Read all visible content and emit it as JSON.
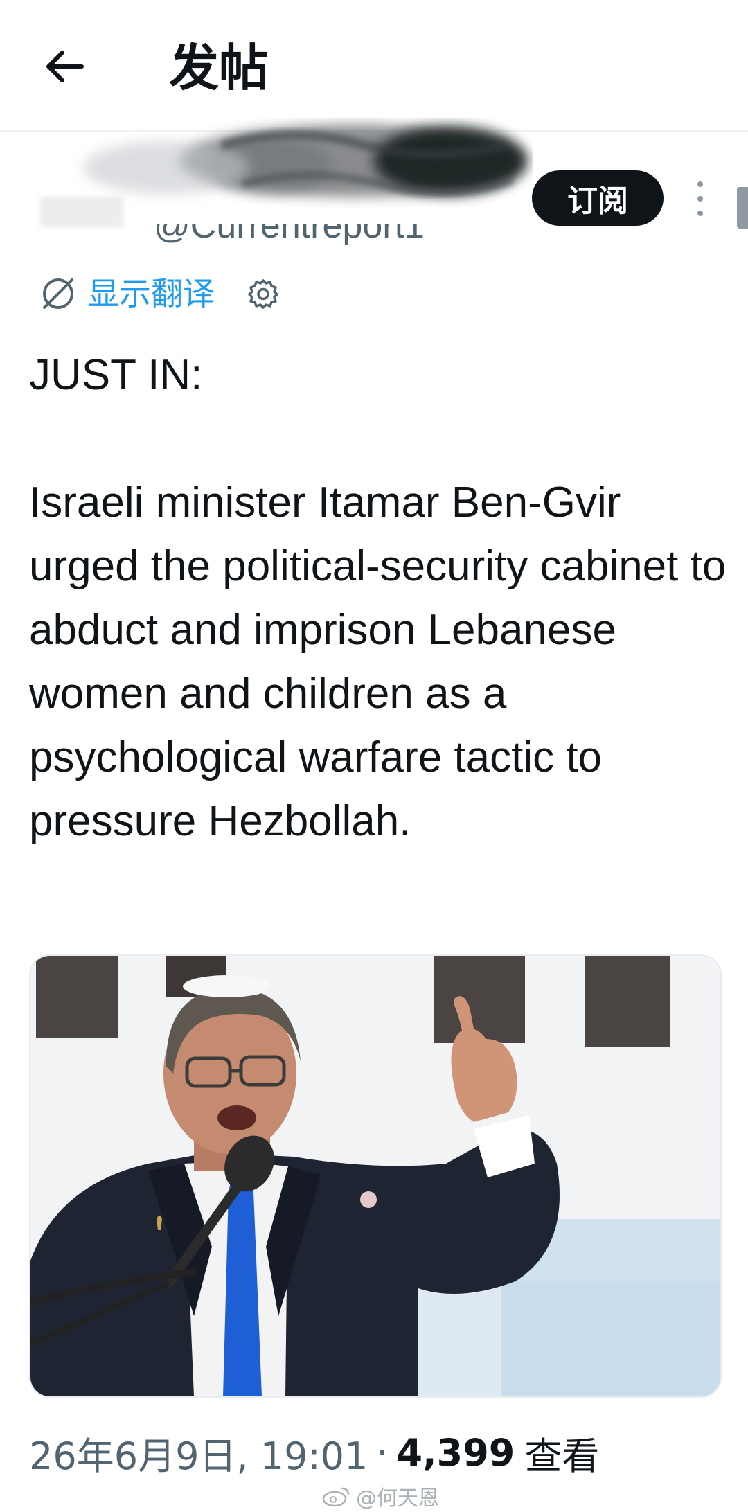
{
  "header": {
    "back_icon": "arrow-left-icon",
    "title": "发帖"
  },
  "author": {
    "handle": "@Currentreport1",
    "subscribe_label": "订阅",
    "more_icon": "more-vertical-icon"
  },
  "translate": {
    "icon": "translate-globe-icon",
    "label": "显示翻译",
    "settings_icon": "gear-icon"
  },
  "tweet": {
    "lead": "JUST IN:",
    "body": "Israeli minister Itamar Ben-Gvir urged the political-security cabinet to abduct and imprison Lebanese women and children as a psychological warfare tactic to pressure Hezbollah."
  },
  "meta": {
    "timestamp": "26年6月9日, 19:01",
    "separator": "·",
    "views_count": "4,399",
    "views_label": "查看"
  },
  "watermark": {
    "text": "@何天恩"
  },
  "colors": {
    "accent": "#1d9bf0",
    "text_primary": "#0f1419",
    "text_secondary": "#536471",
    "tie_blue": "#1f5fd6",
    "suit": "#1f2433"
  }
}
